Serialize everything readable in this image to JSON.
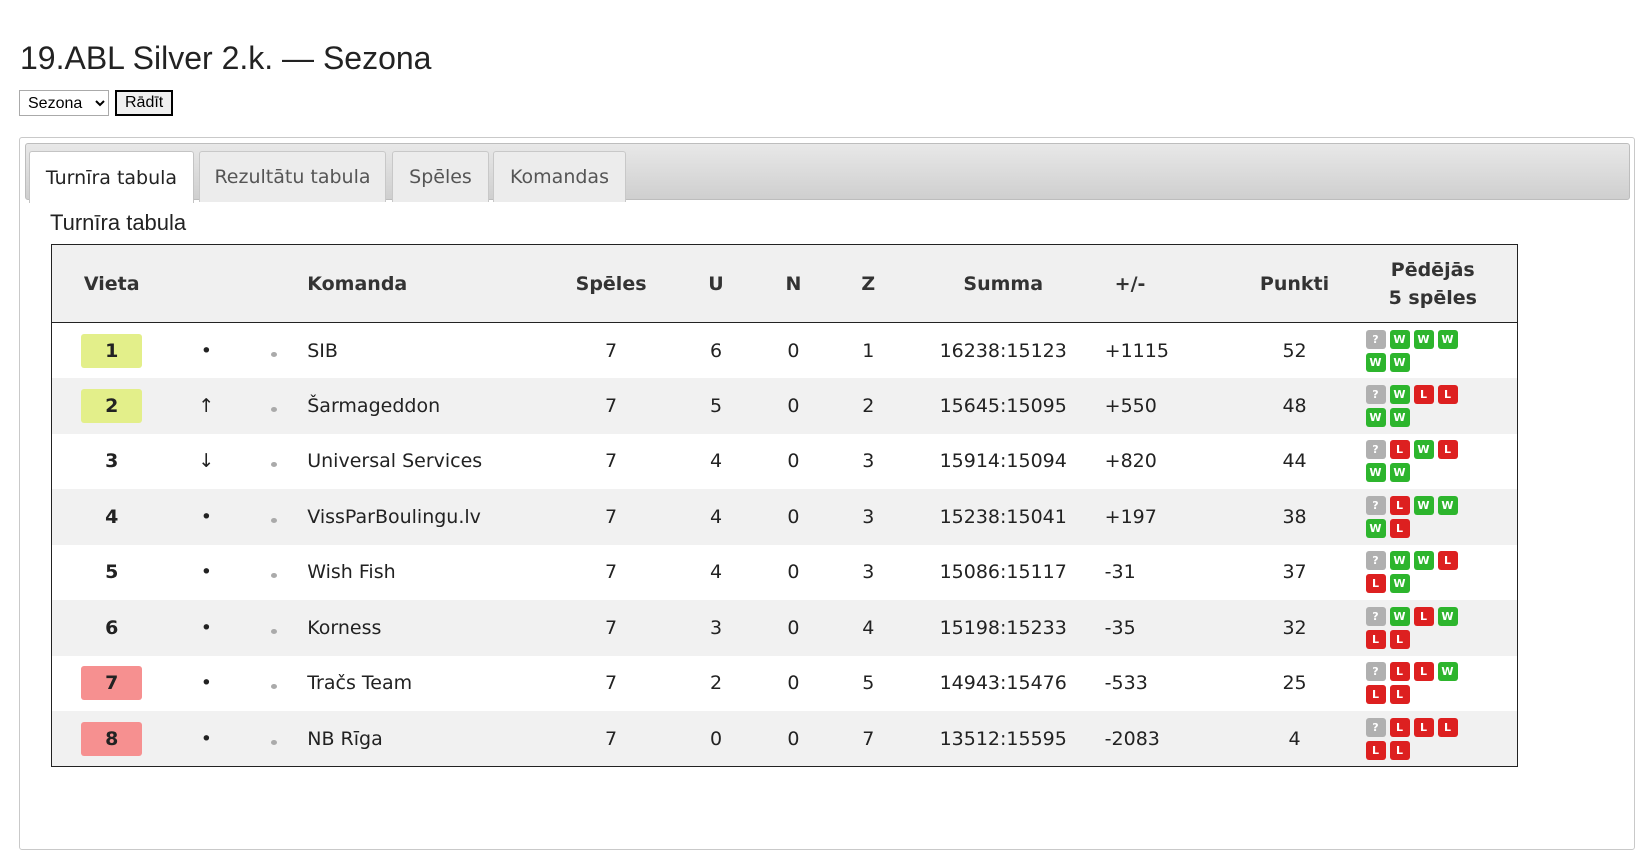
{
  "page": {
    "title": "19.ABL Silver 2.k. — Sezona"
  },
  "controls": {
    "season_value": "Sezona",
    "show_label": "Rādīt"
  },
  "tabs": [
    {
      "label": "Turnīra tabula",
      "active": true
    },
    {
      "label": "Rezultātu tabula",
      "active": false
    },
    {
      "label": "Spēles",
      "active": false
    },
    {
      "label": "Komandas",
      "active": false
    }
  ],
  "section_title": "Turnīra tabula",
  "table": {
    "headers": {
      "vieta": "Vieta",
      "komanda": "Komanda",
      "speles": "Spēles",
      "u": "U",
      "n": "N",
      "z": "Z",
      "summa": "Summa",
      "diff": "+/-",
      "punkti": "Punkti",
      "last5_line1": "Pēdējās",
      "last5_line2": "5 spēles"
    },
    "rows": [
      {
        "rank": "1",
        "zone": "promo",
        "trend": "•",
        "team": "SIB",
        "games": "7",
        "w": "6",
        "d": "0",
        "l": "1",
        "sum": "16238:15123",
        "diff": "+1115",
        "points": "52",
        "last5": [
          "?",
          "W",
          "W",
          "W",
          "W",
          "W"
        ]
      },
      {
        "rank": "2",
        "zone": "promo",
        "trend": "↑",
        "team": "Šarmageddon",
        "games": "7",
        "w": "5",
        "d": "0",
        "l": "2",
        "sum": "15645:15095",
        "diff": "+550",
        "points": "48",
        "last5": [
          "?",
          "W",
          "L",
          "L",
          "W",
          "W"
        ]
      },
      {
        "rank": "3",
        "zone": "plain",
        "trend": "↓",
        "team": "Universal Services",
        "games": "7",
        "w": "4",
        "d": "0",
        "l": "3",
        "sum": "15914:15094",
        "diff": "+820",
        "points": "44",
        "last5": [
          "?",
          "L",
          "W",
          "L",
          "W",
          "W"
        ]
      },
      {
        "rank": "4",
        "zone": "plain",
        "trend": "•",
        "team": "VissParBoulingu.lv",
        "games": "7",
        "w": "4",
        "d": "0",
        "l": "3",
        "sum": "15238:15041",
        "diff": "+197",
        "points": "38",
        "last5": [
          "?",
          "L",
          "W",
          "W",
          "W",
          "L"
        ]
      },
      {
        "rank": "5",
        "zone": "plain",
        "trend": "•",
        "team": "Wish Fish",
        "games": "7",
        "w": "4",
        "d": "0",
        "l": "3",
        "sum": "15086:15117",
        "diff": "-31",
        "points": "37",
        "last5": [
          "?",
          "W",
          "W",
          "L",
          "L",
          "W"
        ]
      },
      {
        "rank": "6",
        "zone": "plain",
        "trend": "•",
        "team": "Korness",
        "games": "7",
        "w": "3",
        "d": "0",
        "l": "4",
        "sum": "15198:15233",
        "diff": "-35",
        "points": "32",
        "last5": [
          "?",
          "W",
          "L",
          "W",
          "L",
          "L"
        ]
      },
      {
        "rank": "7",
        "zone": "releg",
        "trend": "•",
        "team": "Tračs Team",
        "games": "7",
        "w": "2",
        "d": "0",
        "l": "5",
        "sum": "14943:15476",
        "diff": "-533",
        "points": "25",
        "last5": [
          "?",
          "L",
          "L",
          "W",
          "L",
          "L"
        ]
      },
      {
        "rank": "8",
        "zone": "releg",
        "trend": "•",
        "team": "NB Rīga",
        "games": "7",
        "w": "0",
        "d": "0",
        "l": "7",
        "sum": "13512:15595",
        "diff": "-2083",
        "points": "4",
        "last5": [
          "?",
          "L",
          "L",
          "L",
          "L",
          "L"
        ]
      }
    ]
  },
  "colors": {
    "promo": "#e3ef8a",
    "releg": "#f69090",
    "win": "#2db52d",
    "loss": "#dd2020",
    "unknown": "#b0b0b0"
  }
}
